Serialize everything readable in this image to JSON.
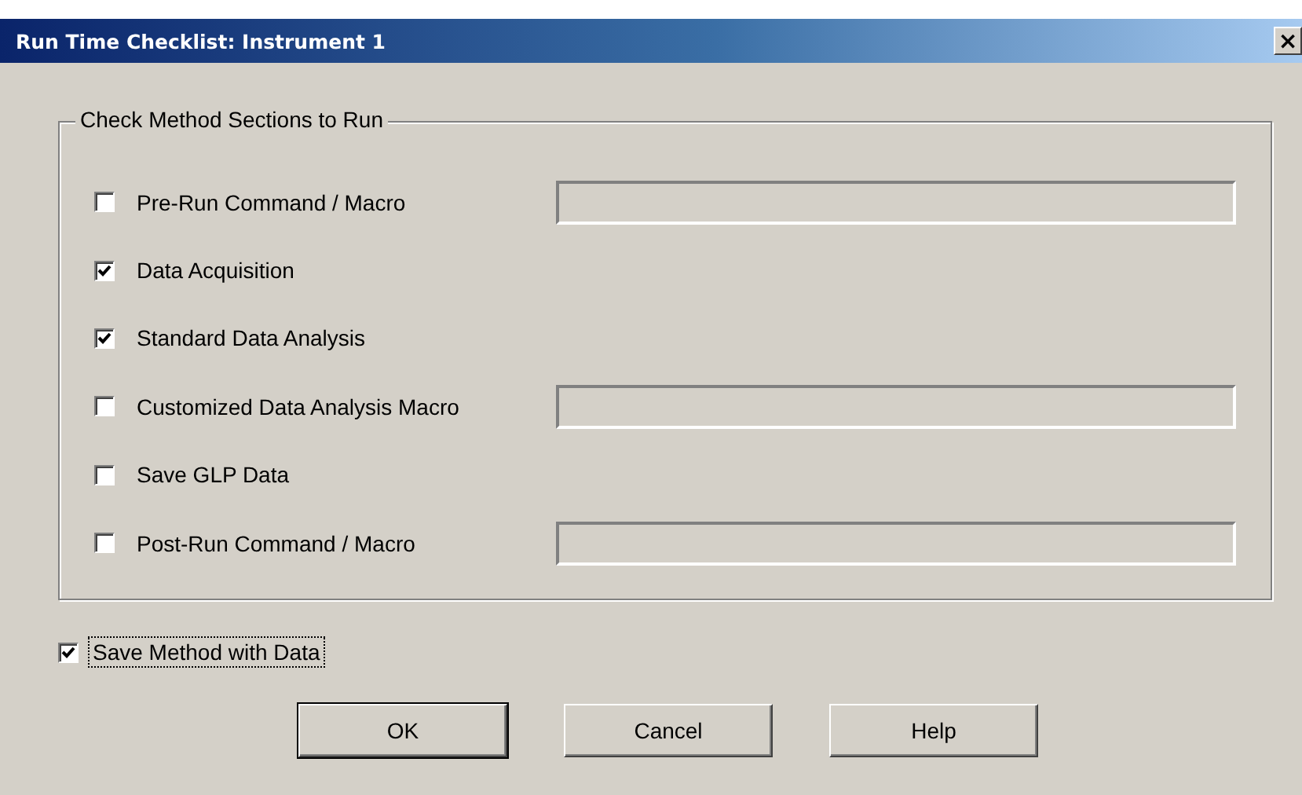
{
  "window": {
    "title": "Run Time Checklist: Instrument 1",
    "close": "×"
  },
  "group": {
    "title": "Check Method Sections to Run",
    "options": [
      {
        "kind": "checkbox_field",
        "label": "Pre-Run Command / Macro",
        "checked": false,
        "field_disabled": true
      },
      {
        "kind": "checkbox",
        "label": "Data Acquisition",
        "checked": true
      },
      {
        "kind": "checkbox",
        "label": "Standard Data Analysis",
        "checked": true
      },
      {
        "kind": "checkbox_field",
        "label": "Customized Data Analysis Macro",
        "checked": false,
        "field_disabled": true
      },
      {
        "kind": "checkbox",
        "label": "Save GLP Data",
        "checked": false
      },
      {
        "kind": "checkbox_field",
        "label": "Post-Run Command / Macro",
        "checked": false,
        "field_disabled": true
      }
    ]
  },
  "save_method": {
    "label": "Save Method with Data",
    "checked": true,
    "focused": true
  },
  "buttons": [
    {
      "label": "OK",
      "default": true
    },
    {
      "label": "Cancel",
      "default": false
    },
    {
      "label": "Help",
      "default": false
    }
  ]
}
